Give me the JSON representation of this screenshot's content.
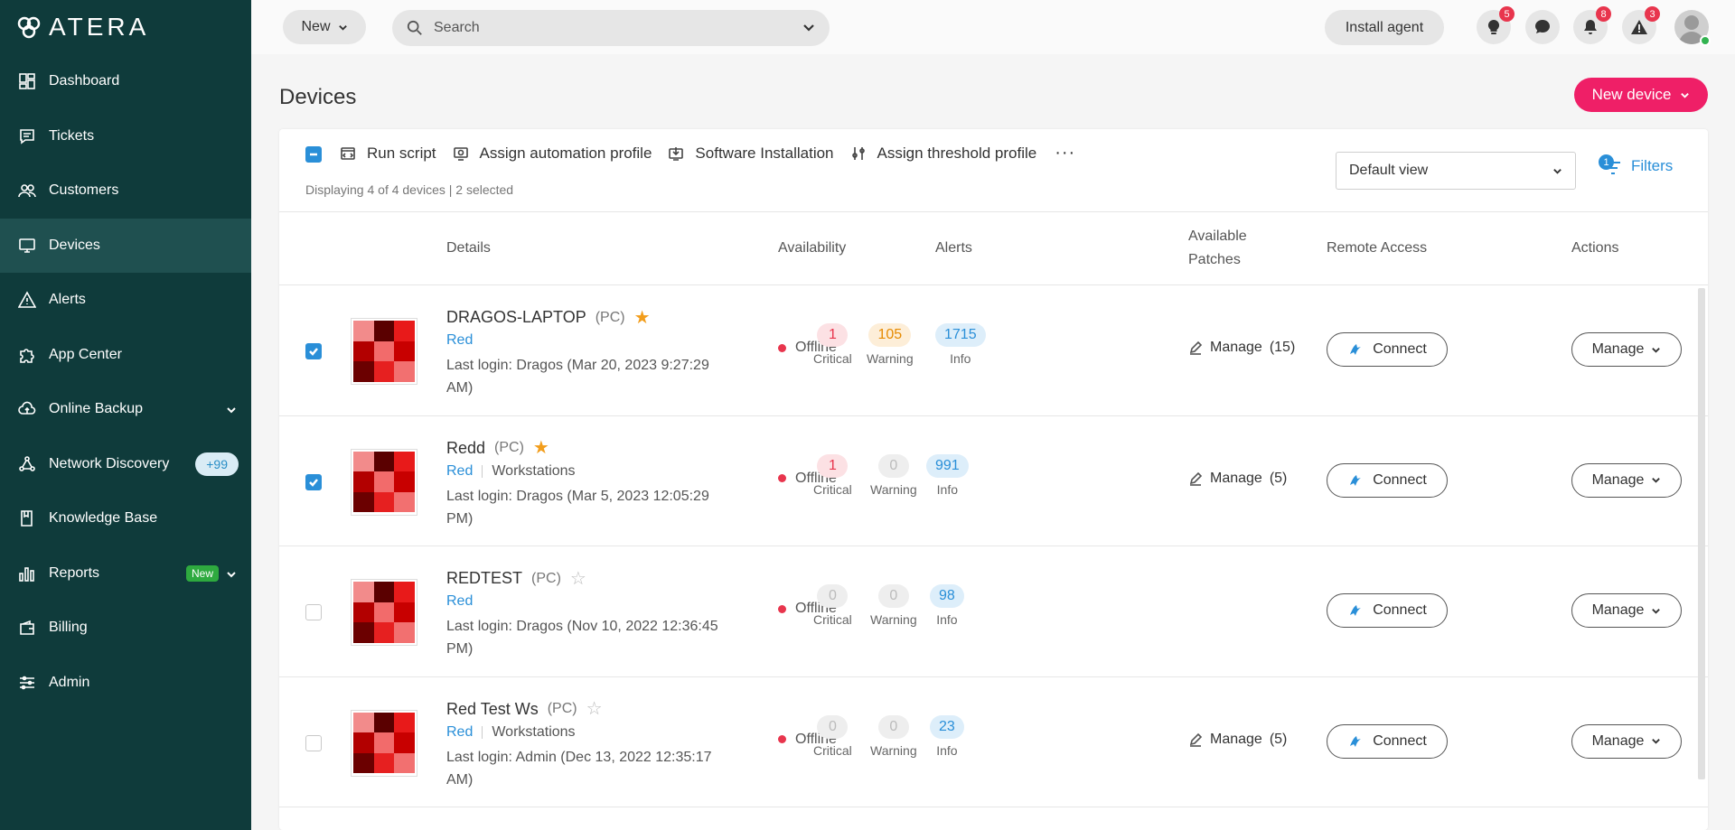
{
  "app": {
    "brand": "ATERA"
  },
  "sidebar": {
    "items": [
      {
        "label": "Dashboard",
        "icon": "dashboard-icon"
      },
      {
        "label": "Tickets",
        "icon": "tickets-icon"
      },
      {
        "label": "Customers",
        "icon": "customers-icon"
      },
      {
        "label": "Devices",
        "icon": "devices-icon",
        "active": true
      },
      {
        "label": "Alerts",
        "icon": "alerts-icon"
      },
      {
        "label": "App Center",
        "icon": "puzzle-icon"
      },
      {
        "label": "Online Backup",
        "icon": "cloud-icon"
      },
      {
        "label": "Network Discovery",
        "icon": "network-icon",
        "badge": "+99"
      },
      {
        "label": "Knowledge Base",
        "icon": "book-icon"
      },
      {
        "label": "Reports",
        "icon": "bar-chart-icon",
        "badge": "New"
      },
      {
        "label": "Billing",
        "icon": "wallet-icon"
      },
      {
        "label": "Admin",
        "icon": "sliders-icon"
      }
    ]
  },
  "topbar": {
    "new_label": "New",
    "search_placeholder": "Search",
    "install_label": "Install agent",
    "badges": {
      "tips": "5",
      "notifications": "8",
      "alerts": "3"
    }
  },
  "page": {
    "title": "Devices",
    "new_device_label": "New device"
  },
  "toolbar": {
    "actions": {
      "run_script": "Run script",
      "assign_automation": "Assign automation profile",
      "software_installation": "Software Installation",
      "assign_threshold": "Assign threshold profile",
      "more": "···"
    },
    "status": "Displaying 4 of 4 devices | 2 selected",
    "view": "Default view",
    "filters_label": "Filters",
    "filters_count": "1"
  },
  "table": {
    "headers": {
      "details": "Details",
      "availability": "Availability",
      "alerts": "Alerts",
      "patches_line1": "Available",
      "patches_line2": "Patches",
      "remote": "Remote Access",
      "actions": "Actions"
    },
    "alert_labels": {
      "critical": "Critical",
      "warning": "Warning",
      "info": "Info"
    },
    "connect_label": "Connect",
    "manage_label": "Manage",
    "rows": [
      {
        "name": "DRAGOS-LAPTOP",
        "type": "(PC)",
        "starred": true,
        "customer": "Red",
        "site": "",
        "login_line1": "Last login: Dragos (Mar 20, 2023 9:27:29",
        "login_line2": "AM)",
        "availability": "Offline",
        "critical": "1",
        "warning": "105",
        "info": "1715",
        "patches": "Manage",
        "patches_count": "(15)",
        "checked": true
      },
      {
        "name": "Redd",
        "type": "(PC)",
        "starred": true,
        "customer": "Red",
        "site": "Workstations",
        "login_line1": "Last login: Dragos (Mar 5, 2023 12:05:29",
        "login_line2": "PM)",
        "availability": "Offline",
        "critical": "1",
        "warning": "0",
        "info": "991",
        "patches": "Manage",
        "patches_count": "(5)",
        "checked": true
      },
      {
        "name": "REDTEST",
        "type": "(PC)",
        "starred": false,
        "customer": "Red",
        "site": "",
        "login_line1": "Last login: Dragos (Nov 10, 2022 12:36:45",
        "login_line2": "PM)",
        "availability": "Offline",
        "critical": "0",
        "warning": "0",
        "info": "98",
        "patches": "",
        "patches_count": "",
        "checked": false
      },
      {
        "name": "Red Test Ws",
        "type": "(PC)",
        "starred": false,
        "customer": "Red",
        "site": "Workstations",
        "login_line1": "Last login: Admin (Dec 13, 2022 12:35:17",
        "login_line2": "AM)",
        "availability": "Offline",
        "critical": "0",
        "warning": "0",
        "info": "23",
        "patches": "Manage",
        "patches_count": "(5)",
        "checked": false
      }
    ]
  },
  "colors": {
    "sidebar_bg": "#0f3b3b",
    "accent_pink": "#ef1f67",
    "link_blue": "#2a8fd8",
    "offline_red": "#e8354d",
    "star_orange": "#f29d1b"
  },
  "thumbnail_palette": [
    "#f28b8b",
    "#5a0000",
    "#e81a1a",
    "#b20000",
    "#f26b6b",
    "#c80000",
    "#6b0000",
    "#e62020",
    "#f27070"
  ]
}
